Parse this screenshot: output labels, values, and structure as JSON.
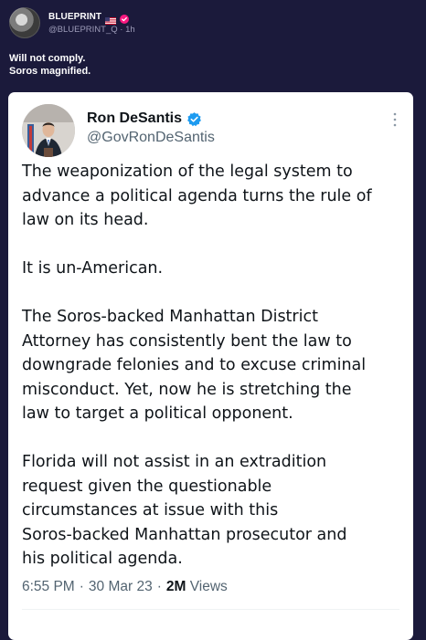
{
  "post": {
    "display_name": "BLUEPRINT",
    "handle": "@BLUEPRINT_Q",
    "separator": "·",
    "time_ago": "1h",
    "flag_icon": "us-flag-icon",
    "badge_icon": "verified-badge-icon",
    "text_lines": [
      "Will not comply.",
      "Soros magnified."
    ]
  },
  "quoted_tweet": {
    "name": "Ron DeSantis",
    "handle": "@GovRonDeSantis",
    "verified_icon": "verified-icon",
    "more_icon": "more-options-icon",
    "paragraphs": [
      [
        "The weaponization of the legal system to",
        "advance a political agenda turns the rule of",
        "law on its head."
      ],
      [
        "It is un-American."
      ],
      [
        "The Soros-backed Manhattan District",
        "Attorney has consistently bent the law to",
        "downgrade felonies and to excuse criminal",
        "misconduct. Yet, now he is stretching the",
        "law to target a political opponent."
      ],
      [
        "Florida will not assist in an extradition",
        "request given the questionable",
        "circumstances at issue with this",
        "Soros-backed Manhattan prosecutor and",
        "his political agenda."
      ]
    ],
    "time": "6:55 PM",
    "dot1": "·",
    "date": "30 Mar 23",
    "dot2": "·",
    "views_count": "2M",
    "views_label": "Views"
  },
  "colors": {
    "background": "#1b1a3b",
    "card": "#ffffff",
    "verified_blue": "#1d9bf0",
    "badge_pink": "#f91880"
  }
}
